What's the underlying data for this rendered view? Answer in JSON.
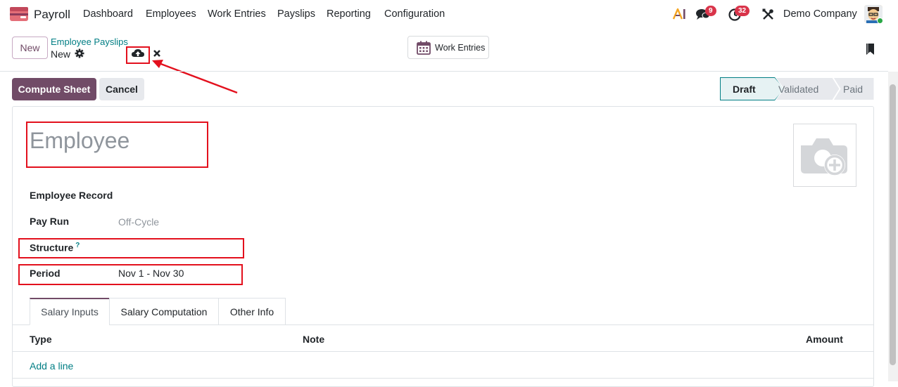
{
  "navbar": {
    "app_name": "Payroll",
    "menu": [
      "Dashboard",
      "Employees",
      "Work Entries",
      "Payslips",
      "Reporting",
      "Configuration"
    ],
    "messages_badge": "9",
    "activities_badge": "32",
    "company": "Demo Company"
  },
  "control_panel": {
    "new_label": "New",
    "breadcrumb": "Employee Payslips",
    "record_name": "New",
    "work_entries_label": "Work Entries"
  },
  "form": {
    "compute_label": "Compute Sheet",
    "cancel_label": "Cancel",
    "statusbar": [
      "Draft",
      "Validated",
      "Paid"
    ],
    "active_status": "Draft",
    "employee_placeholder": "Employee",
    "fields": {
      "employee_record_label": "Employee Record",
      "pay_run_label": "Pay Run",
      "pay_run_value": "Off-Cycle",
      "structure_label": "Structure",
      "structure_help": "?",
      "period_label": "Period",
      "period_value": "Nov 1 - Nov 30"
    },
    "tabs": [
      "Salary Inputs",
      "Salary Computation",
      "Other Info"
    ],
    "table": {
      "columns": [
        "Type",
        "Note",
        "Amount"
      ],
      "add_line": "Add a line"
    }
  },
  "colors": {
    "brand": "#714b67",
    "link": "#017e84",
    "highlight": "#e3101d",
    "badge": "#d9344a"
  }
}
